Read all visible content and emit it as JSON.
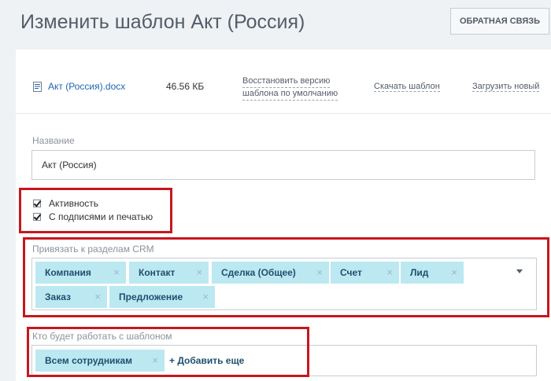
{
  "header": {
    "title": "Изменить шаблон Акт (Россия)",
    "feedback_label": "ОБРАТНАЯ СВЯЗЬ"
  },
  "file": {
    "icon": "word-document-icon",
    "name": "Акт (Россия).docx",
    "size": "46.56 КБ",
    "restore_line1": "Восстановить версию",
    "restore_line2": "шаблона по умолчанию",
    "download_label": "Скачать шаблон",
    "upload_label": "Загрузить новый"
  },
  "name_field": {
    "label": "Название",
    "value": "Акт (Россия)"
  },
  "checkboxes": {
    "active": {
      "label": "Активность",
      "checked": true
    },
    "with_signature": {
      "label": "С подписями и печатью",
      "checked": true
    }
  },
  "crm": {
    "label": "Привязать к разделам CRM",
    "tags": [
      "Компания",
      "Контакт",
      "Сделка (Общее)",
      "Счет",
      "Лид",
      "Заказ",
      "Предложение"
    ],
    "remove_symbol": "×"
  },
  "users": {
    "label": "Кто будет работать с шаблоном",
    "tags": [
      "Всем сотрудникам"
    ],
    "add_more_label": "+ Добавить еще"
  },
  "colors": {
    "accent": "#2067b0",
    "tag_bg": "#bce8f1",
    "highlight": "#c8161d"
  }
}
